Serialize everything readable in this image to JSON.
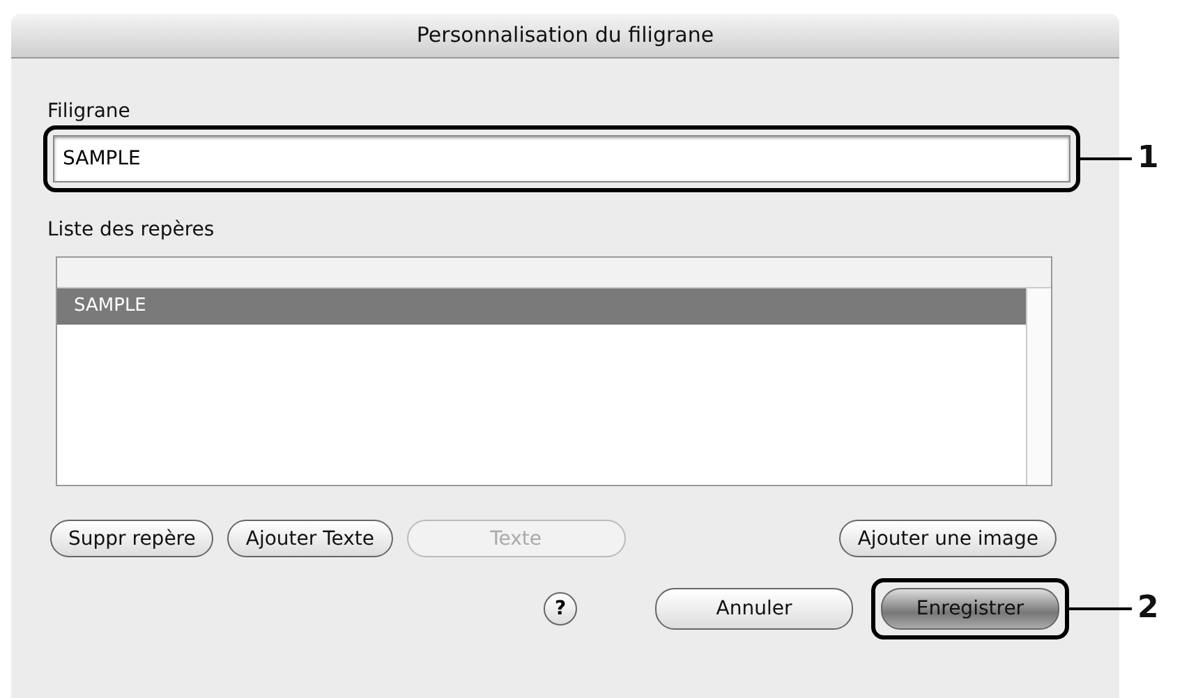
{
  "window": {
    "title": "Personnalisation du filigrane"
  },
  "watermark_field": {
    "label": "Filigrane",
    "value": "SAMPLE",
    "callout": "1"
  },
  "marks_list": {
    "label": "Liste des repères",
    "items": [
      {
        "text": "SAMPLE",
        "selected": true
      }
    ]
  },
  "list_buttons": [
    {
      "label": "Suppr repère",
      "disabled": false
    },
    {
      "label": "Ajouter Texte",
      "disabled": false
    },
    {
      "label": "Texte",
      "disabled": true
    },
    {
      "label": "Ajouter une image",
      "disabled": false
    }
  ],
  "help_button": {
    "text": "?"
  },
  "footer_buttons": [
    {
      "label": "Annuler",
      "default": false
    },
    {
      "label": "Enregistrer",
      "default": true,
      "callout": "2"
    }
  ]
}
